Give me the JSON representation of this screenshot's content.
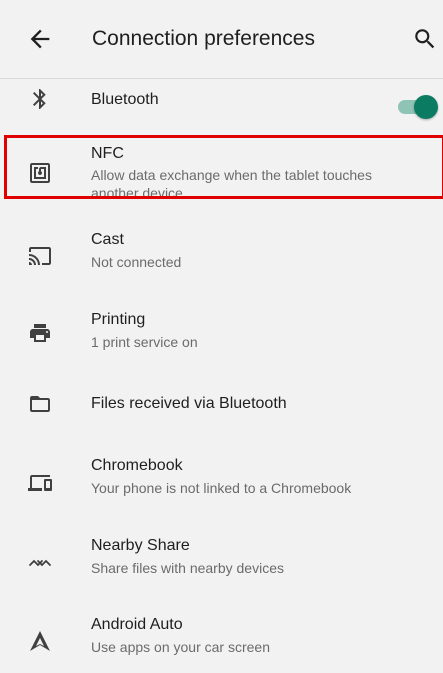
{
  "appbar": {
    "back_icon": "arrow-back-icon",
    "title": "Connection preferences",
    "search_icon": "search-icon"
  },
  "items": [
    {
      "id": "bluetooth",
      "icon": "bluetooth-icon",
      "title": "Bluetooth",
      "subtitle": ""
    },
    {
      "id": "nfc",
      "icon": "nfc-icon",
      "title": "NFC",
      "subtitle": "Allow data exchange when the tablet touches another device",
      "toggle": true
    },
    {
      "id": "cast",
      "icon": "cast-icon",
      "title": "Cast",
      "subtitle": "Not connected"
    },
    {
      "id": "printing",
      "icon": "printer-icon",
      "title": "Printing",
      "subtitle": "1 print service on"
    },
    {
      "id": "files-bluetooth",
      "icon": "folder-icon",
      "title": "Files received via Bluetooth",
      "subtitle": ""
    },
    {
      "id": "chromebook",
      "icon": "devices-icon",
      "title": "Chromebook",
      "subtitle": "Your phone is not linked to a Chromebook"
    },
    {
      "id": "nearby-share",
      "icon": "nearby-share-icon",
      "title": "Nearby Share",
      "subtitle": "Share files with nearby devices"
    },
    {
      "id": "android-auto",
      "icon": "android-auto-icon",
      "title": "Android Auto",
      "subtitle": "Use apps on your car screen"
    }
  ],
  "colors": {
    "accent": "#0b7b61",
    "accent_track": "#8fc3b5",
    "highlight": "#e00000",
    "background": "#f2f2f2"
  }
}
